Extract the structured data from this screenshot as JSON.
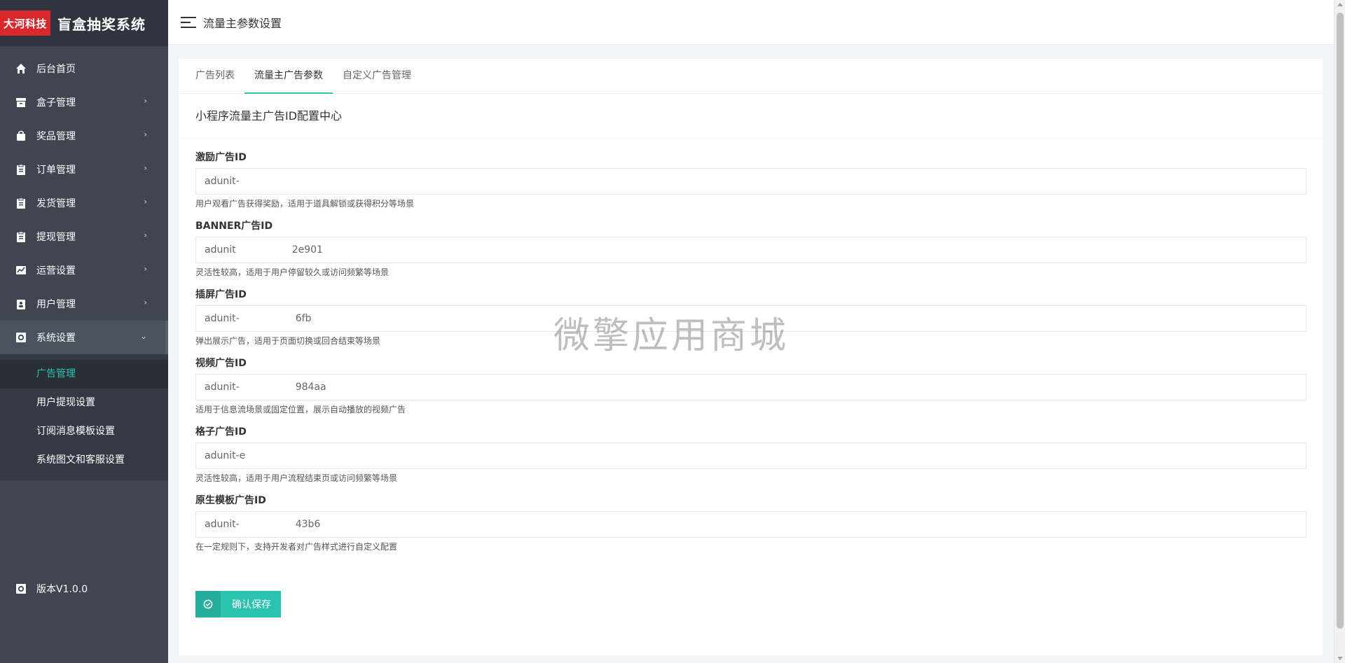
{
  "brand": {
    "logo_text": "大河科技",
    "title": "盲盒抽奖系统"
  },
  "header": {
    "title": "流量主参数设置"
  },
  "sidebar": {
    "items": [
      {
        "label": "后台首页",
        "icon": "home-icon",
        "has_children": false
      },
      {
        "label": "盒子管理",
        "icon": "box-icon",
        "has_children": true
      },
      {
        "label": "奖品管理",
        "icon": "bag-icon",
        "has_children": true
      },
      {
        "label": "订单管理",
        "icon": "clipboard-icon",
        "has_children": true
      },
      {
        "label": "发货管理",
        "icon": "clipboard-icon",
        "has_children": true
      },
      {
        "label": "提现管理",
        "icon": "clipboard-icon",
        "has_children": true
      },
      {
        "label": "运营设置",
        "icon": "chart-icon",
        "has_children": true
      },
      {
        "label": "用户管理",
        "icon": "user-card-icon",
        "has_children": true
      },
      {
        "label": "系统设置",
        "icon": "gear-icon",
        "has_children": true,
        "open": true
      }
    ],
    "submenu": [
      {
        "label": "广告管理",
        "active": true
      },
      {
        "label": "用户提现设置"
      },
      {
        "label": "订阅消息模板设置"
      },
      {
        "label": "系统图文和客服设置"
      }
    ],
    "version": "版本V1.0.0"
  },
  "tabs": [
    {
      "label": "广告列表"
    },
    {
      "label": "流量主广告参数",
      "active": true
    },
    {
      "label": "自定义广告管理"
    }
  ],
  "section_title": "小程序流量主广告ID配置中心",
  "fields": [
    {
      "label": "激励广告ID",
      "value": "adunit-",
      "help": "用户观看广告获得奖励，适用于道具解锁或获得积分等场景"
    },
    {
      "label": "BANNER广告ID",
      "value": "adunit                  2e901",
      "help": "灵活性较高，适用于用户停留较久或访问频繁等场景"
    },
    {
      "label": "插屏广告ID",
      "value": "adunit-                  6fb",
      "help": "弹出展示广告，适用于页面切换或回合结束等场景"
    },
    {
      "label": "视频广告ID",
      "value": "adunit-                  984aa",
      "help": "适用于信息流场景或固定位置，展示自动播放的视频广告"
    },
    {
      "label": "格子广告ID",
      "value": "adunit-e",
      "help": "灵活性较高，适用于用户流程结束页或访问频繁等场景"
    },
    {
      "label": "原生模板广告ID",
      "value": "adunit-                  43b6",
      "help": "在一定规则下，支持开发者对广告样式进行自定义配置"
    }
  ],
  "submit_label": "确认保存",
  "watermark": "微擎应用商城",
  "colors": {
    "accent": "#2bc3b0",
    "sidebar_bg": "#3f4651",
    "brand_red": "#d8282d"
  }
}
